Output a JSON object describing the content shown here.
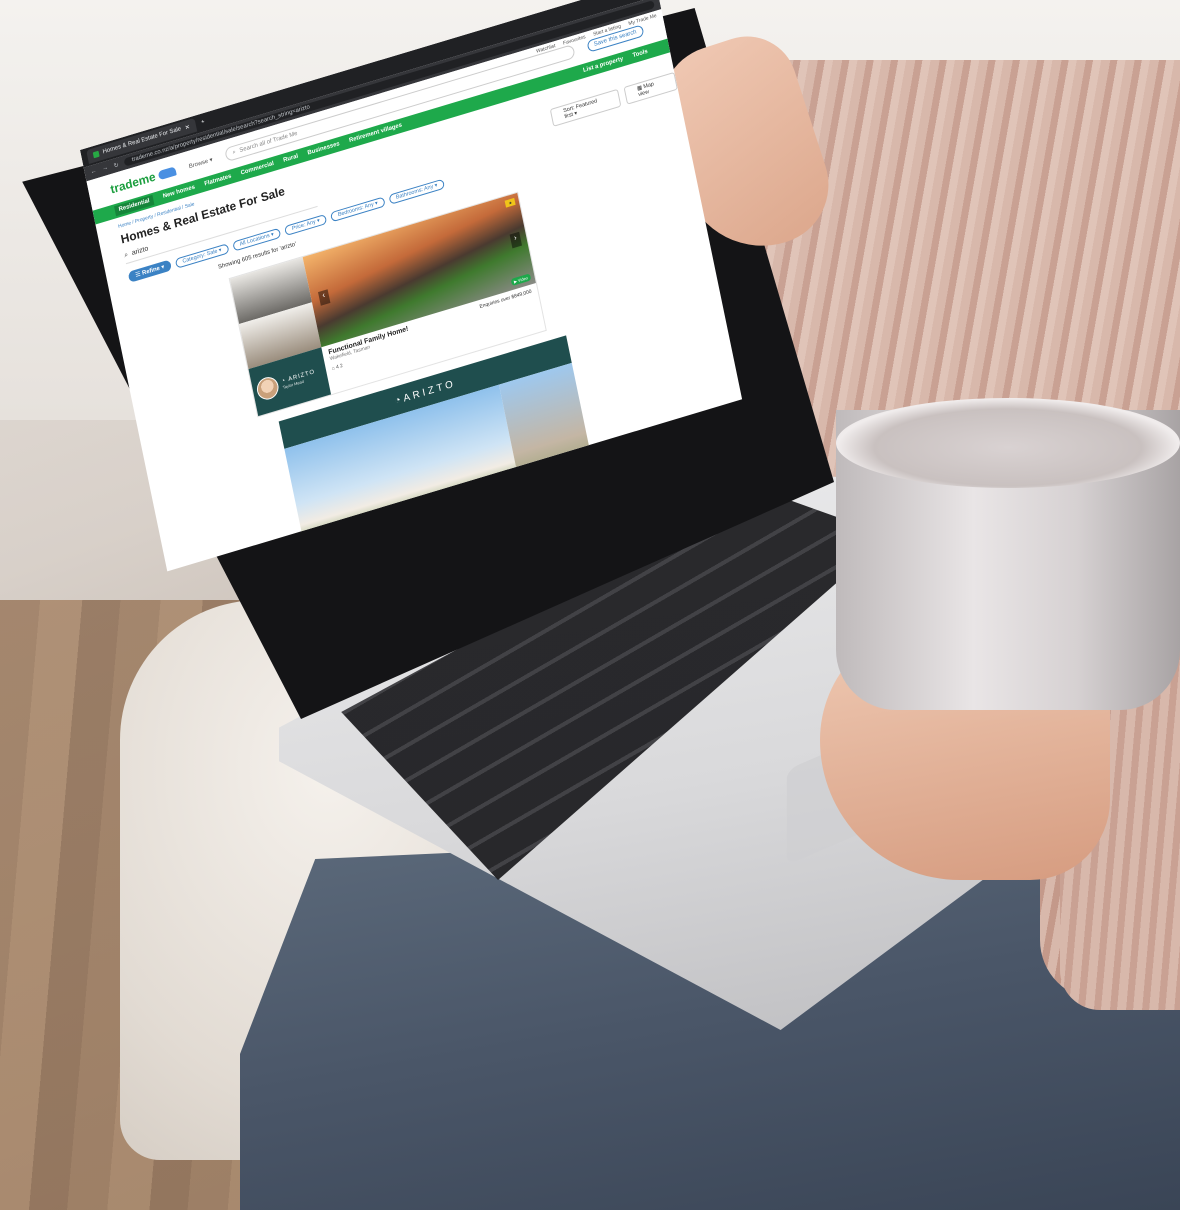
{
  "browser": {
    "tab_title": "Homes & Real Estate For Sale",
    "url": "trademe.co.nz/a/property/residential/sale/search?search_string=arizto"
  },
  "site": {
    "logo_text": "trademe",
    "browse_label": "Browse",
    "search_placeholder": "Search all of Trade Me",
    "save_search_label": "Save this search",
    "utility": [
      "Watchlist",
      "Favourites",
      "Start a listing",
      "My Trade Me"
    ]
  },
  "nav": {
    "items": [
      "Residential",
      "New homes",
      "Flatmates",
      "Commercial",
      "Rural",
      "Businesses",
      "Retirement villages"
    ],
    "right_label": "List a property",
    "tools_label": "Tools"
  },
  "page": {
    "breadcrumb": "Home / Property / Residential / Sale",
    "title": "Homes & Real Estate For Sale",
    "query": "arizto",
    "filters": [
      "Refine",
      "Category: Sale",
      "All Locations",
      "Price: Any",
      "Bedrooms: Any",
      "Bathrooms: Any"
    ],
    "sort_label": "Sort: Featured first",
    "map_view_label": "Map view",
    "results_text": "Showing 605 results for 'arizto'"
  },
  "listing": {
    "title": "Functional Family Home!",
    "location": "Wakefield, Tasman",
    "features": "4  2",
    "price": "Enquiries over $849,000",
    "agency": "ARIZTO",
    "agent_name": "Taylor Mead",
    "video_badge": "Video"
  },
  "banner": {
    "brand": "ARIZTO"
  },
  "colors": {
    "trademe_green": "#1ea94b",
    "link_blue": "#3b82c4",
    "arizto_teal": "#1f4e4e"
  }
}
